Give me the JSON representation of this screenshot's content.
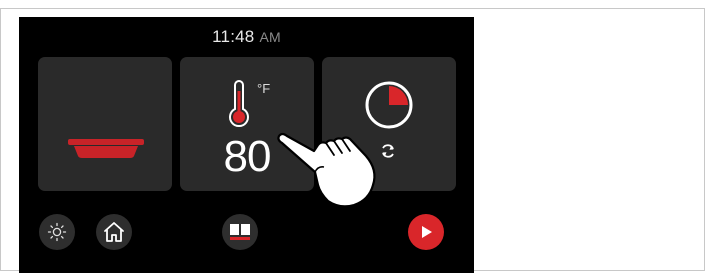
{
  "status_bar": {
    "time": "11:48",
    "ampm": "AM"
  },
  "tiles": {
    "pan": {
      "icon": "pan-icon",
      "color": "#c82328"
    },
    "temperature": {
      "icon": "thermometer-icon",
      "unit": "°F",
      "value": "80"
    },
    "timer": {
      "icon": "timer-icon",
      "secondary_icon": "repeat-icon"
    }
  },
  "gesture": {
    "icon": "tap-hand-icon"
  },
  "bottom_bar": {
    "buttons": [
      {
        "icon": "light-icon"
      },
      {
        "icon": "home-icon"
      },
      {
        "icon": "recipe-book-icon"
      },
      {
        "icon": "play-icon",
        "color": "#d9262a"
      }
    ]
  },
  "colors": {
    "screen_bg": "#000000",
    "tile_bg": "#2a2a2a",
    "accent": "#d9262a"
  }
}
